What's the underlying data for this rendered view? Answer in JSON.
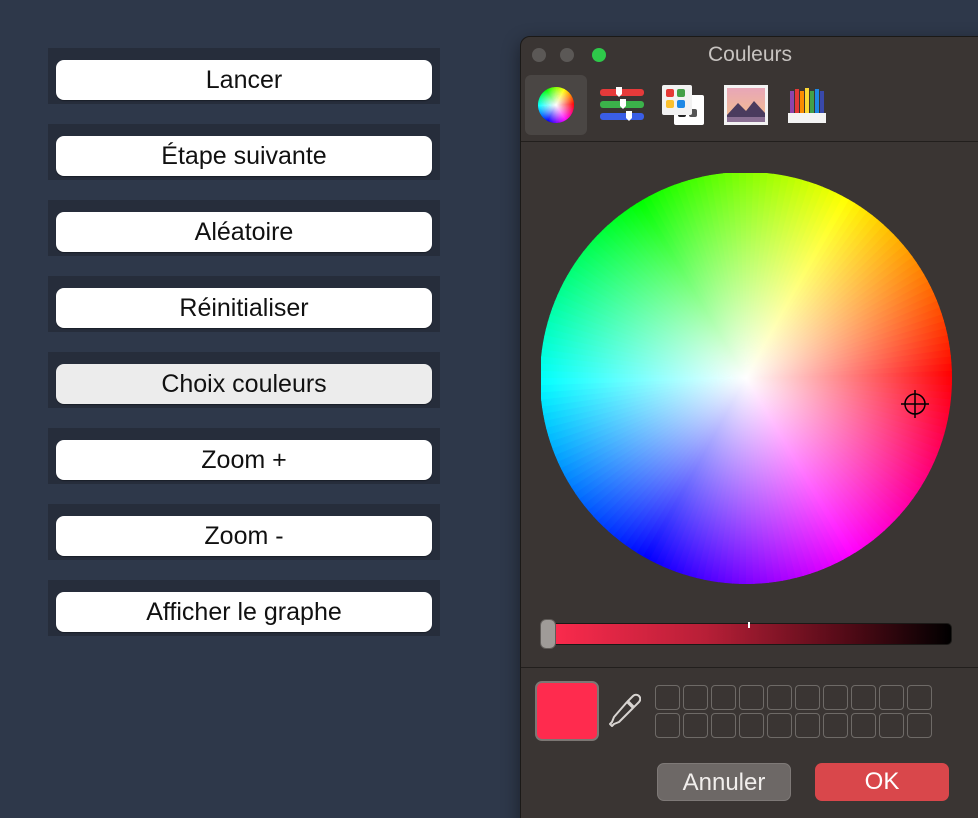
{
  "buttons": [
    {
      "label": "Lancer"
    },
    {
      "label": "Étape suivante"
    },
    {
      "label": "Aléatoire"
    },
    {
      "label": "Réinitialiser"
    },
    {
      "label": "Choix couleurs"
    },
    {
      "label": "Zoom +"
    },
    {
      "label": "Zoom -"
    },
    {
      "label": "Afficher le graphe"
    }
  ],
  "color_panel": {
    "title": "Couleurs",
    "tabs": [
      {
        "icon": "color-wheel-icon",
        "selected": true
      },
      {
        "icon": "color-sliders-icon",
        "selected": false
      },
      {
        "icon": "color-palettes-icon",
        "selected": false
      },
      {
        "icon": "image-palettes-icon",
        "selected": false
      },
      {
        "icon": "pencils-icon",
        "selected": false
      }
    ],
    "current_color": "#ff2b4e",
    "brightness_fraction": 0.0,
    "cancel_label": "Annuler",
    "ok_label": "OK",
    "ok_color": "#d9474b"
  }
}
